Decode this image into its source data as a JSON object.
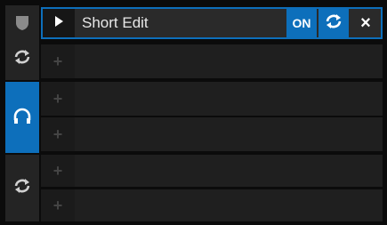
{
  "colors": {
    "accent": "#0d6fbb",
    "panel": "#242424",
    "row": "#1f1f1f",
    "bg": "#0b0b0b"
  },
  "rail": {
    "top": {
      "icons": [
        "shield-icon",
        "loop-icon"
      ]
    },
    "middle": {
      "icon": "headphones-icon"
    },
    "bottom": {
      "icon": "loop-icon"
    }
  },
  "active_slot": {
    "title": "Short Edit",
    "on_label": "ON",
    "close_glyph": "×"
  },
  "empty_slots": {
    "add_glyph": "+"
  }
}
